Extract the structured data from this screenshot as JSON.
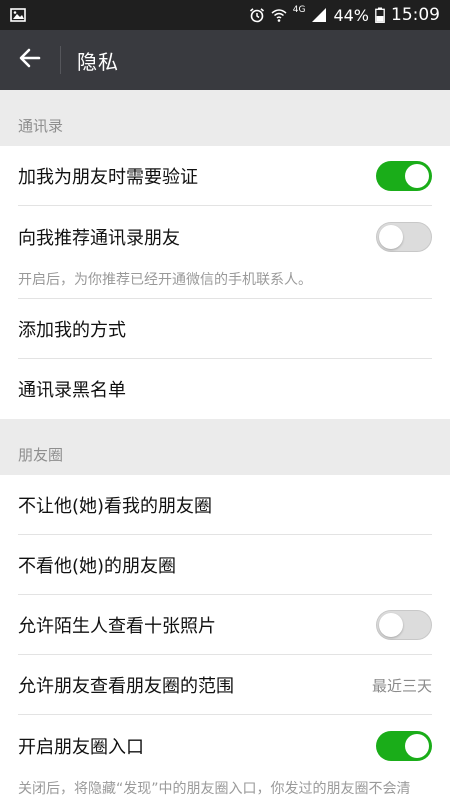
{
  "status_bar": {
    "battery_percent": "44%",
    "time": "15:09",
    "network": "4G"
  },
  "header": {
    "title": "隐私"
  },
  "sections": {
    "contacts": {
      "title": "通讯录",
      "items": {
        "verify": {
          "label": "加我为朋友时需要验证",
          "enabled": true
        },
        "recommend": {
          "label": "向我推荐通讯录朋友",
          "enabled": false,
          "description": "开启后，为你推荐已经开通微信的手机联系人。"
        },
        "add_methods": {
          "label": "添加我的方式"
        },
        "blacklist": {
          "label": "通讯录黑名单"
        }
      }
    },
    "moments": {
      "title": "朋友圈",
      "items": {
        "hide_from": {
          "label": "不让他(她)看我的朋友圈"
        },
        "dont_see": {
          "label": "不看他(她)的朋友圈"
        },
        "stranger_ten": {
          "label": "允许陌生人查看十张照片",
          "enabled": false
        },
        "range": {
          "label": "允许朋友查看朋友圈的范围",
          "value": "最近三天"
        },
        "entry": {
          "label": "开启朋友圈入口",
          "enabled": true,
          "description": "关闭后，将隐藏“发现”中的朋友圈入口，你发过的朋友圈不会清空，朋友仍可以看到。"
        }
      }
    }
  },
  "colors": {
    "toggle_on": "#1aad19",
    "title_bar": "#393a3f",
    "status_bar": "#1f1f1f"
  }
}
